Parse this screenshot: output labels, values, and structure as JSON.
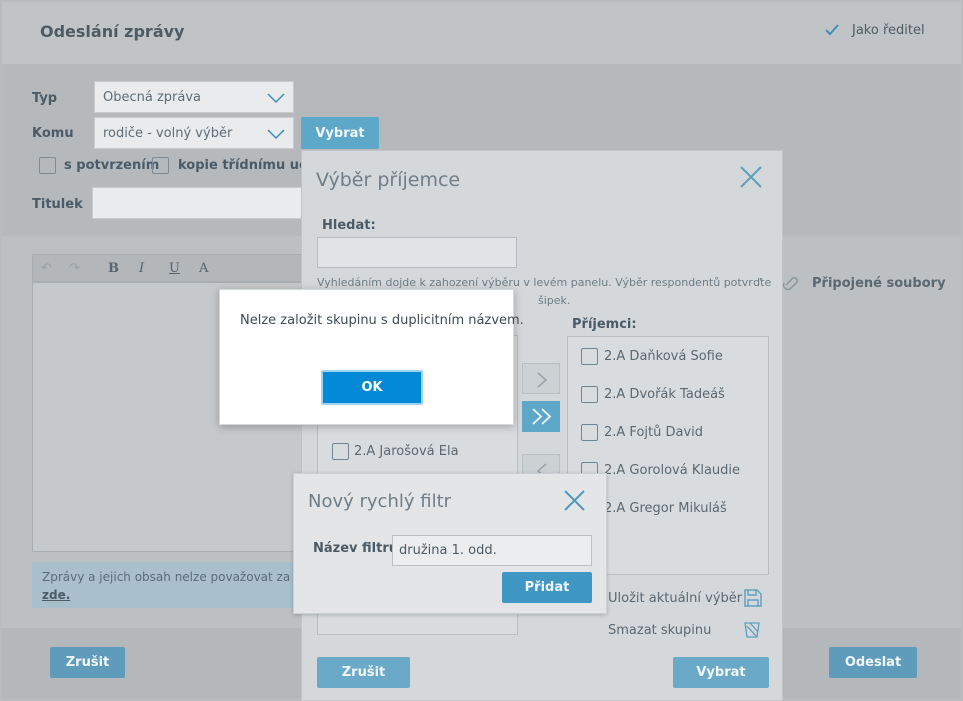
{
  "header": {
    "title": "Odeslání zprávy",
    "role": "Jako ředitel"
  },
  "form": {
    "type_label": "Typ",
    "type_value": "Obecná zpráva",
    "to_label": "Komu",
    "to_value": "rodiče - volný výběr",
    "select_button": "Vybrat",
    "with_confirmation": "s potvrzením",
    "copy_teacher": "kopie třídnímu učite",
    "subject_label": "Titulek",
    "subject_value": ""
  },
  "editor": {
    "toolbar": [
      "B",
      "I",
      "U",
      "A"
    ],
    "notice": "Zprávy a jejich obsah nelze považovat za soukr",
    "notice_link": "zde."
  },
  "attachments_label": "Připojené soubory",
  "footer": {
    "cancel": "Zrušit",
    "send": "Odeslat"
  },
  "recipient_dialog": {
    "title": "Výběr příjemce",
    "search_label": "Hledat:",
    "search_value": "",
    "hint_line1": "Vyhledáním dojde k zahození výběru v levém panelu. Výběr respondentů potvrďte",
    "hint_line2": "šipek.",
    "left_items": [
      "2.A Jarošová Ela"
    ],
    "recipients_label": "Příjemci:",
    "recipients": [
      "2.A Daňková Sofie",
      "2.A Dvořák Tadeáš",
      "2.A Fojtů David",
      "2.A Gorolová Klaudie",
      "2.A Gregor Mikuláš"
    ],
    "save_selection": "Uložit aktuální výběr",
    "delete_group": "Smazat skupinu",
    "cancel": "Zrušit",
    "confirm": "Vybrat"
  },
  "filter_dialog": {
    "title": "Nový rychlý filtr",
    "name_label": "Název filtru:",
    "name_value": "družina 1. odd.",
    "add_button": "Přidat"
  },
  "alert": {
    "message": "Nelze založit skupinu s duplicitním názvem.",
    "ok_button": "OK"
  }
}
